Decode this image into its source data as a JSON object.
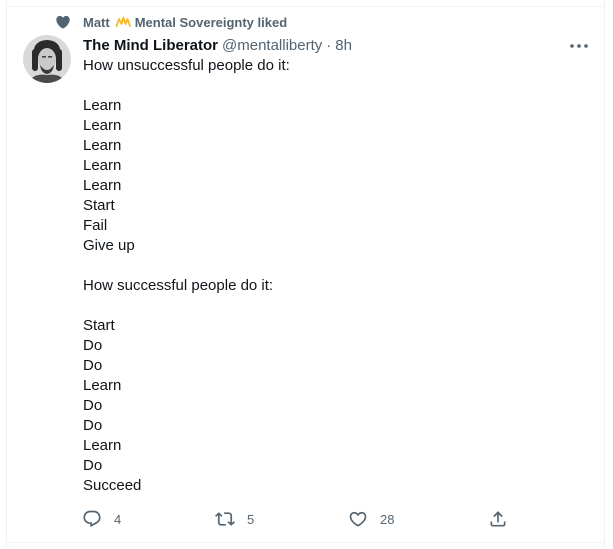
{
  "social_context": {
    "name": "Matt",
    "rest": "Mental Sovereignty liked"
  },
  "tweet": {
    "display_name": "The Mind Liberator",
    "handle": "@mentalliberty",
    "separator": "·",
    "time": "8h",
    "lines": [
      "How unsuccessful people do it:",
      "",
      "Learn",
      "Learn",
      "Learn",
      "Learn",
      "Learn",
      "Start",
      "Fail",
      "Give up",
      "",
      "How successful people do it:",
      "",
      "Start",
      "Do",
      "Do",
      "Learn",
      "Do",
      "Do",
      "Learn",
      "Do",
      "Succeed"
    ]
  },
  "actions": {
    "reply_count": "4",
    "retweet_count": "5",
    "like_count": "28"
  },
  "colors": {
    "text_primary": "#0f1419",
    "text_secondary": "#536471",
    "crown": "#f7b928"
  },
  "icons": [
    "heart-icon",
    "crown-icon",
    "more-icon",
    "reply-icon",
    "retweet-icon",
    "like-icon",
    "share-icon"
  ]
}
